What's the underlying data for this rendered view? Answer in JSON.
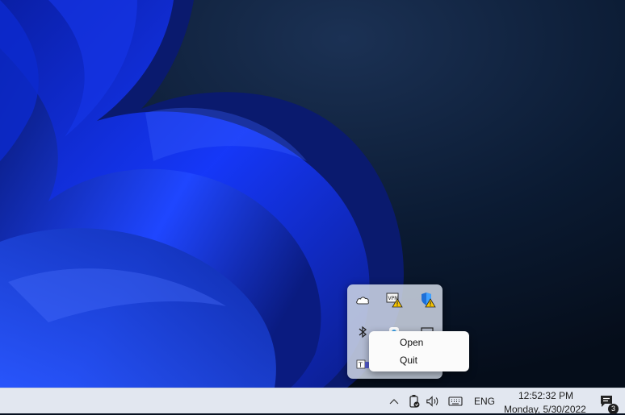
{
  "desktop": {
    "wallpaper": "windows-11-bloom-wallpaper",
    "colors": {
      "background_dark": "#06101f",
      "bloom_blue": "#1a3cff"
    }
  },
  "tray_flyout": {
    "icons": [
      "onedrive-icon",
      "vpn-warning-icon",
      "defender-warning-icon",
      "bluetooth-icon",
      "app-icon",
      "display-icon",
      "teams-icon"
    ]
  },
  "context_menu": {
    "items": [
      {
        "label": "Open"
      },
      {
        "label": "Quit"
      }
    ]
  },
  "taskbar": {
    "icons": [
      "chevron-up-icon",
      "battery-icon",
      "volume-icon",
      "keyboard-icon"
    ],
    "language": "ENG",
    "clock": {
      "time": "12:52:32 PM",
      "date": "Monday, 5/30/2022"
    },
    "notifications": {
      "icon": "chat-icon",
      "count": "3"
    }
  }
}
